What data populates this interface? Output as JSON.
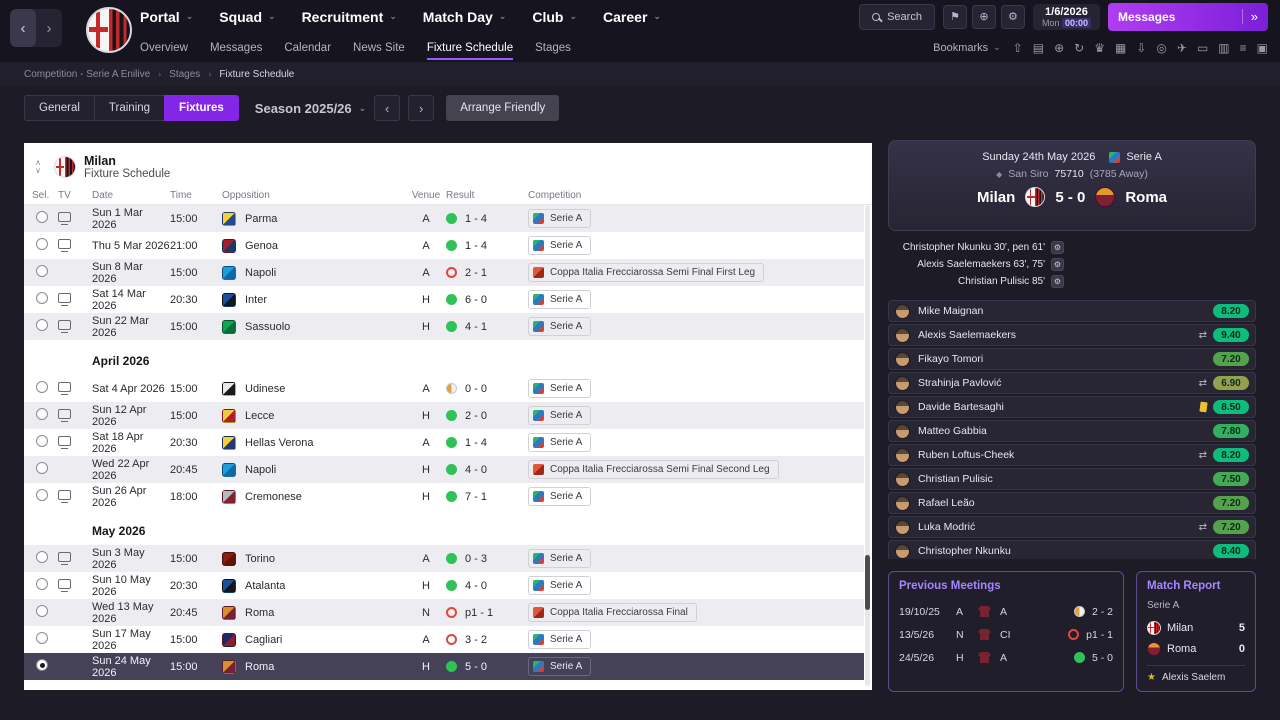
{
  "header": {
    "nav_back": "‹",
    "nav_forward": "›",
    "menus": [
      "Portal",
      "Squad",
      "Recruitment",
      "Match Day",
      "Club",
      "Career"
    ],
    "search_label": "Search",
    "icon_buttons": [
      {
        "name": "flag-icon",
        "glyph": "⚑"
      },
      {
        "name": "globe-icon",
        "glyph": "⊕"
      },
      {
        "name": "settings-gear-icon",
        "glyph": "⚙"
      }
    ],
    "datetime": {
      "date": "1/6/2026",
      "day": "Mon",
      "time": "00:00"
    },
    "messages": {
      "label": "Messages",
      "chevron": "»"
    }
  },
  "subnav": {
    "items": [
      "Overview",
      "Messages",
      "Calendar",
      "News Site",
      "Fixture Schedule",
      "Stages"
    ],
    "active_index": 4,
    "bookmarks_label": "Bookmarks",
    "caret": "⌄",
    "icons": [
      {
        "name": "upload-icon",
        "glyph": "⇧"
      },
      {
        "name": "notes-icon",
        "glyph": "▤"
      },
      {
        "name": "globe-icon",
        "glyph": "⊕"
      },
      {
        "name": "refresh-icon",
        "glyph": "↻"
      },
      {
        "name": "trophy-icon",
        "glyph": "♛"
      },
      {
        "name": "calendar-icon",
        "glyph": "▦"
      },
      {
        "name": "download-icon",
        "glyph": "⇩"
      },
      {
        "name": "finance-icon",
        "glyph": "◎"
      },
      {
        "name": "travel-icon",
        "glyph": "✈"
      },
      {
        "name": "card-icon",
        "glyph": "▭"
      },
      {
        "name": "stats-icon",
        "glyph": "▥"
      },
      {
        "name": "list-icon",
        "glyph": "≡"
      },
      {
        "name": "news-icon",
        "glyph": "▣"
      }
    ]
  },
  "breadcrumb": [
    "Competition - Serie A Enilive",
    "Stages",
    "Fixture Schedule"
  ],
  "toolbar": {
    "tabs": [
      "General",
      "Training",
      "Fixtures"
    ],
    "active_tab_index": 2,
    "season_label": "Season 2025/26",
    "season_caret": "⌄",
    "prev_icon": "‹",
    "next_icon": "›",
    "arrange_friendly_label": "Arrange Friendly"
  },
  "fixtures": {
    "club": "Milan",
    "subtitle": "Fixture Schedule",
    "sort_up": "∧",
    "sort_down": "∨",
    "columns": [
      "Sel.",
      "TV",
      "Date",
      "Time",
      "Opposition",
      "Venue",
      "Result",
      "Competition"
    ],
    "sections": [
      {
        "month": "",
        "rows": [
          {
            "tv": true,
            "date": "Sun 1 Mar 2026",
            "time": "15:00",
            "opponent": "Parma",
            "badge": [
              "#f2d23c",
              "#27488f"
            ],
            "venue": "A",
            "result": "1 - 4",
            "outcome": "win",
            "competition": "Serie A",
            "comp_type": "league",
            "selected": false
          },
          {
            "tv": true,
            "date": "Thu 5 Mar 2026",
            "time": "21:00",
            "opponent": "Genoa",
            "badge": [
              "#a31e2b",
              "#1b3a6b"
            ],
            "venue": "A",
            "result": "1 - 4",
            "outcome": "win",
            "competition": "Serie A",
            "comp_type": "league",
            "selected": false
          },
          {
            "tv": false,
            "date": "Sun 8 Mar 2026",
            "time": "15:00",
            "opponent": "Napoli",
            "badge": [
              "#1e9fd8",
              "#0c6aa8"
            ],
            "venue": "A",
            "result": "2 - 1",
            "outcome": "loss",
            "competition": "Coppa Italia Frecciarossa Semi Final First Leg",
            "comp_type": "cup",
            "selected": false
          },
          {
            "tv": true,
            "date": "Sat 14 Mar 2026",
            "time": "20:30",
            "opponent": "Inter",
            "badge": [
              "#1b4fa0",
              "#101820"
            ],
            "venue": "H",
            "result": "6 - 0",
            "outcome": "win",
            "competition": "Serie A",
            "comp_type": "league",
            "selected": false
          },
          {
            "tv": true,
            "date": "Sun 22 Mar 2026",
            "time": "15:00",
            "opponent": "Sassuolo",
            "badge": [
              "#12a552",
              "#0a6e38"
            ],
            "venue": "H",
            "result": "4 - 1",
            "outcome": "win",
            "competition": "Serie A",
            "comp_type": "league",
            "selected": false
          }
        ]
      },
      {
        "month": "April 2026",
        "rows": [
          {
            "tv": true,
            "date": "Sat 4 Apr 2026",
            "time": "15:00",
            "opponent": "Udinese",
            "badge": [
              "#e8e8e8",
              "#1a1a1a"
            ],
            "venue": "A",
            "result": "0 - 0",
            "outcome": "draw",
            "competition": "Serie A",
            "comp_type": "league",
            "selected": false
          },
          {
            "tv": true,
            "date": "Sun 12 Apr 2026",
            "time": "15:00",
            "opponent": "Lecce",
            "badge": [
              "#f2c83c",
              "#b01e28"
            ],
            "venue": "H",
            "result": "2 - 0",
            "outcome": "win",
            "competition": "Serie A",
            "comp_type": "league",
            "selected": false
          },
          {
            "tv": true,
            "date": "Sat 18 Apr 2026",
            "time": "20:30",
            "opponent": "Hellas Verona",
            "badge": [
              "#f2d23c",
              "#223a7a"
            ],
            "venue": "A",
            "result": "1 - 4",
            "outcome": "win",
            "competition": "Serie A",
            "comp_type": "league",
            "selected": false
          },
          {
            "tv": false,
            "date": "Wed 22 Apr 2026",
            "time": "20:45",
            "opponent": "Napoli",
            "badge": [
              "#1e9fd8",
              "#0c6aa8"
            ],
            "venue": "H",
            "result": "4 - 0",
            "outcome": "win",
            "competition": "Coppa Italia Frecciarossa Semi Final Second Leg",
            "comp_type": "cup",
            "selected": false
          },
          {
            "tv": true,
            "date": "Sun 26 Apr 2026",
            "time": "18:00",
            "opponent": "Cremonese",
            "badge": [
              "#b8b8c0",
              "#8a1e2b"
            ],
            "venue": "H",
            "result": "7 - 1",
            "outcome": "win",
            "competition": "Serie A",
            "comp_type": "league",
            "selected": false
          }
        ]
      },
      {
        "month": "May 2026",
        "rows": [
          {
            "tv": true,
            "date": "Sun 3 May 2026",
            "time": "15:00",
            "opponent": "Torino",
            "badge": [
              "#8a1e12",
              "#5e1208"
            ],
            "venue": "A",
            "result": "0 - 3",
            "outcome": "win",
            "competition": "Serie A",
            "comp_type": "league",
            "selected": false
          },
          {
            "tv": true,
            "date": "Sun 10 May 2026",
            "time": "20:30",
            "opponent": "Atalanta",
            "badge": [
              "#1b4fa0",
              "#15151c"
            ],
            "venue": "H",
            "result": "4 - 0",
            "outcome": "win",
            "competition": "Serie A",
            "comp_type": "league",
            "selected": false
          },
          {
            "tv": false,
            "date": "Wed 13 May 2026",
            "time": "20:45",
            "opponent": "Roma",
            "badge": [
              "#d98f2b",
              "#7a1f35"
            ],
            "venue": "N",
            "result": "p1 - 1",
            "outcome": "loss",
            "competition": "Coppa Italia Frecciarossa Final",
            "comp_type": "cup",
            "selected": false
          },
          {
            "tv": false,
            "date": "Sun 17 May 2026",
            "time": "15:00",
            "opponent": "Cagliari",
            "badge": [
              "#1b2a6b",
              "#8a1e2b"
            ],
            "venue": "A",
            "result": "3 - 2",
            "outcome": "loss",
            "competition": "Serie A",
            "comp_type": "league",
            "selected": false
          },
          {
            "tv": false,
            "date": "Sun 24 May 2026",
            "time": "15:00",
            "opponent": "Roma",
            "badge": [
              "#d98f2b",
              "#7a1f35"
            ],
            "venue": "H",
            "result": "5 - 0",
            "outcome": "win",
            "competition": "Serie A",
            "comp_type": "league",
            "selected": true
          }
        ]
      }
    ]
  },
  "match": {
    "date": "Sunday 24th May 2026",
    "competition": "Serie A",
    "stadium_icon": "◆",
    "stadium": "San Siro",
    "attendance": "75710",
    "away_attendance": "(3785 Away)",
    "home_team": "Milan",
    "away_team": "Roma",
    "score": "5 - 0",
    "scorers": [
      {
        "name": "Christopher Nkunku",
        "times": "30', pen 61'"
      },
      {
        "name": "Alexis Saelemaekers",
        "times": "63', 75'"
      },
      {
        "name": "Christian Pulisic",
        "times": "85'"
      }
    ],
    "ratings": [
      {
        "name": "Mike Maignan",
        "rating": "8.20",
        "color": "#0ebd7c"
      },
      {
        "name": "Alexis Saelemaekers",
        "rating": "9.40",
        "color": "#0ebd7c",
        "sub": true
      },
      {
        "name": "Fikayo Tomori",
        "rating": "7.20",
        "color": "#55a24c"
      },
      {
        "name": "Strahinja Pavlović",
        "rating": "6.90",
        "color": "#93a04e",
        "sub": true
      },
      {
        "name": "Davide Bartesaghi",
        "rating": "8.50",
        "color": "#0ebd7c",
        "card": "yellow"
      },
      {
        "name": "Matteo Gabbia",
        "rating": "7.80",
        "color": "#33b05f"
      },
      {
        "name": "Ruben Loftus-Cheek",
        "rating": "8.20",
        "color": "#0ebd7c",
        "sub": true
      },
      {
        "name": "Christian Pulisic",
        "rating": "7.50",
        "color": "#44aa55"
      },
      {
        "name": "Rafael Leão",
        "rating": "7.20",
        "color": "#55a24c"
      },
      {
        "name": "Luka Modrić",
        "rating": "7.20",
        "color": "#55a24c",
        "sub": true
      },
      {
        "name": "Christopher Nkunku",
        "rating": "8.40",
        "color": "#0ebd7c"
      }
    ]
  },
  "previous_meetings": {
    "title": "Previous Meetings",
    "rows": [
      {
        "date": "19/10/25",
        "venue": "A",
        "comp": "A",
        "result": "2 - 2",
        "outcome": "draw"
      },
      {
        "date": "13/5/26",
        "venue": "N",
        "comp": "CI",
        "result": "p1 - 1",
        "outcome": "loss"
      },
      {
        "date": "24/5/26",
        "venue": "H",
        "comp": "A",
        "result": "5 - 0",
        "outcome": "win"
      }
    ]
  },
  "match_report": {
    "title": "Match Report",
    "competition": "Serie A",
    "home": {
      "name": "Milan",
      "score": "5"
    },
    "away": {
      "name": "Roma",
      "score": "0"
    },
    "star_icon": "★",
    "star_player": "Alexis Saelem"
  }
}
